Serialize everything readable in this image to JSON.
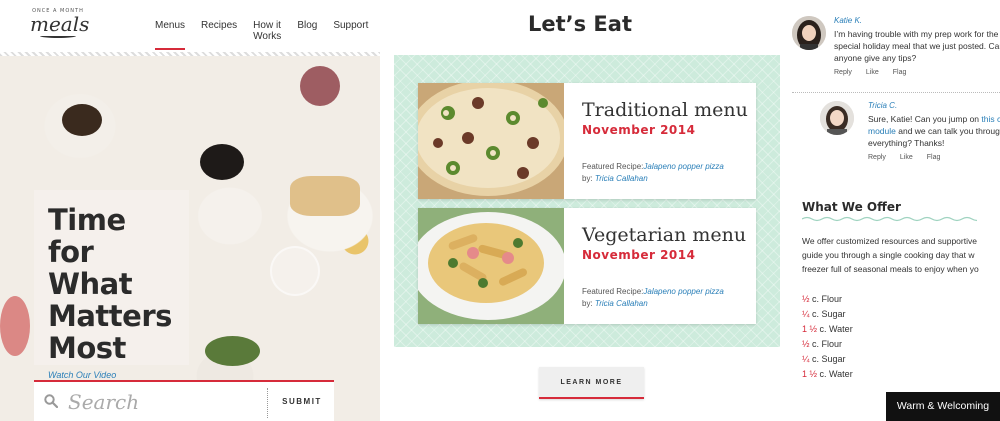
{
  "nav": {
    "logo_top": "ONCE A MONTH",
    "logo_main": "meals",
    "links": [
      {
        "label": "Menus",
        "active": true
      },
      {
        "label": "Recipes",
        "active": false
      },
      {
        "label": "How it Works",
        "active": false
      },
      {
        "label": "Blog",
        "active": false
      },
      {
        "label": "Support",
        "active": false
      }
    ]
  },
  "hero": {
    "title_lines": [
      "Time for",
      "What",
      "Matters",
      "Most"
    ],
    "video_link": "Watch Our Video"
  },
  "search": {
    "placeholder": "Search",
    "submit_label": "SUBMIT"
  },
  "middle": {
    "title": "Let’s Eat",
    "menus": [
      {
        "name": "Traditional menu",
        "date": "November 2014",
        "featured_label": "Featured Recipe:",
        "featured_recipe": "Jalapeno popper pizza",
        "by_label": "by:",
        "author": "Tricia Callahan"
      },
      {
        "name": "Vegetarian menu",
        "date": "November 2014",
        "featured_label": "Featured Recipe:",
        "featured_recipe": "Jalapeno popper pizza",
        "by_label": "by:",
        "author": "Tricia Callahan"
      }
    ],
    "learn_more": "LEARN MORE"
  },
  "comments": [
    {
      "author": "Katie K.",
      "lines": [
        "I’m having trouble with my prep work for the",
        "special holiday meal that we just posted. Can",
        "anyone give any tips?"
      ],
      "actions": [
        "Reply",
        "Like",
        "Flag"
      ]
    },
    {
      "author": "Tricia C.",
      "line1_pre": "Sure, Katie! Can you jump on ",
      "line1_link": "this ch",
      "line2_link": "module",
      "line2_post": " and we can talk you through",
      "line3": "everything? Thanks!",
      "actions": [
        "Reply",
        "Like",
        "Flag"
      ]
    }
  ],
  "offer": {
    "heading": "What We Offer",
    "text_lines": [
      "We offer customized resources and supportive",
      "guide you through a single cooking day that w",
      "freezer full of seasonal meals to enjoy when yo"
    ],
    "ingredients": [
      {
        "qty": "½",
        "item": " c. Flour"
      },
      {
        "qty": "¼",
        "item": " c. Sugar"
      },
      {
        "qty": "1 ½",
        "item": " c. Water"
      },
      {
        "qty": "½",
        "item": " c. Flour"
      },
      {
        "qty": "¼",
        "item": " c. Sugar"
      },
      {
        "qty": "1 ½",
        "item": " c. Water"
      }
    ]
  },
  "tag_label": "Warm & Welcoming",
  "colors": {
    "accent_red": "#d62b3a",
    "mint": "#cdebdc",
    "link_blue": "#2a7fb8"
  }
}
